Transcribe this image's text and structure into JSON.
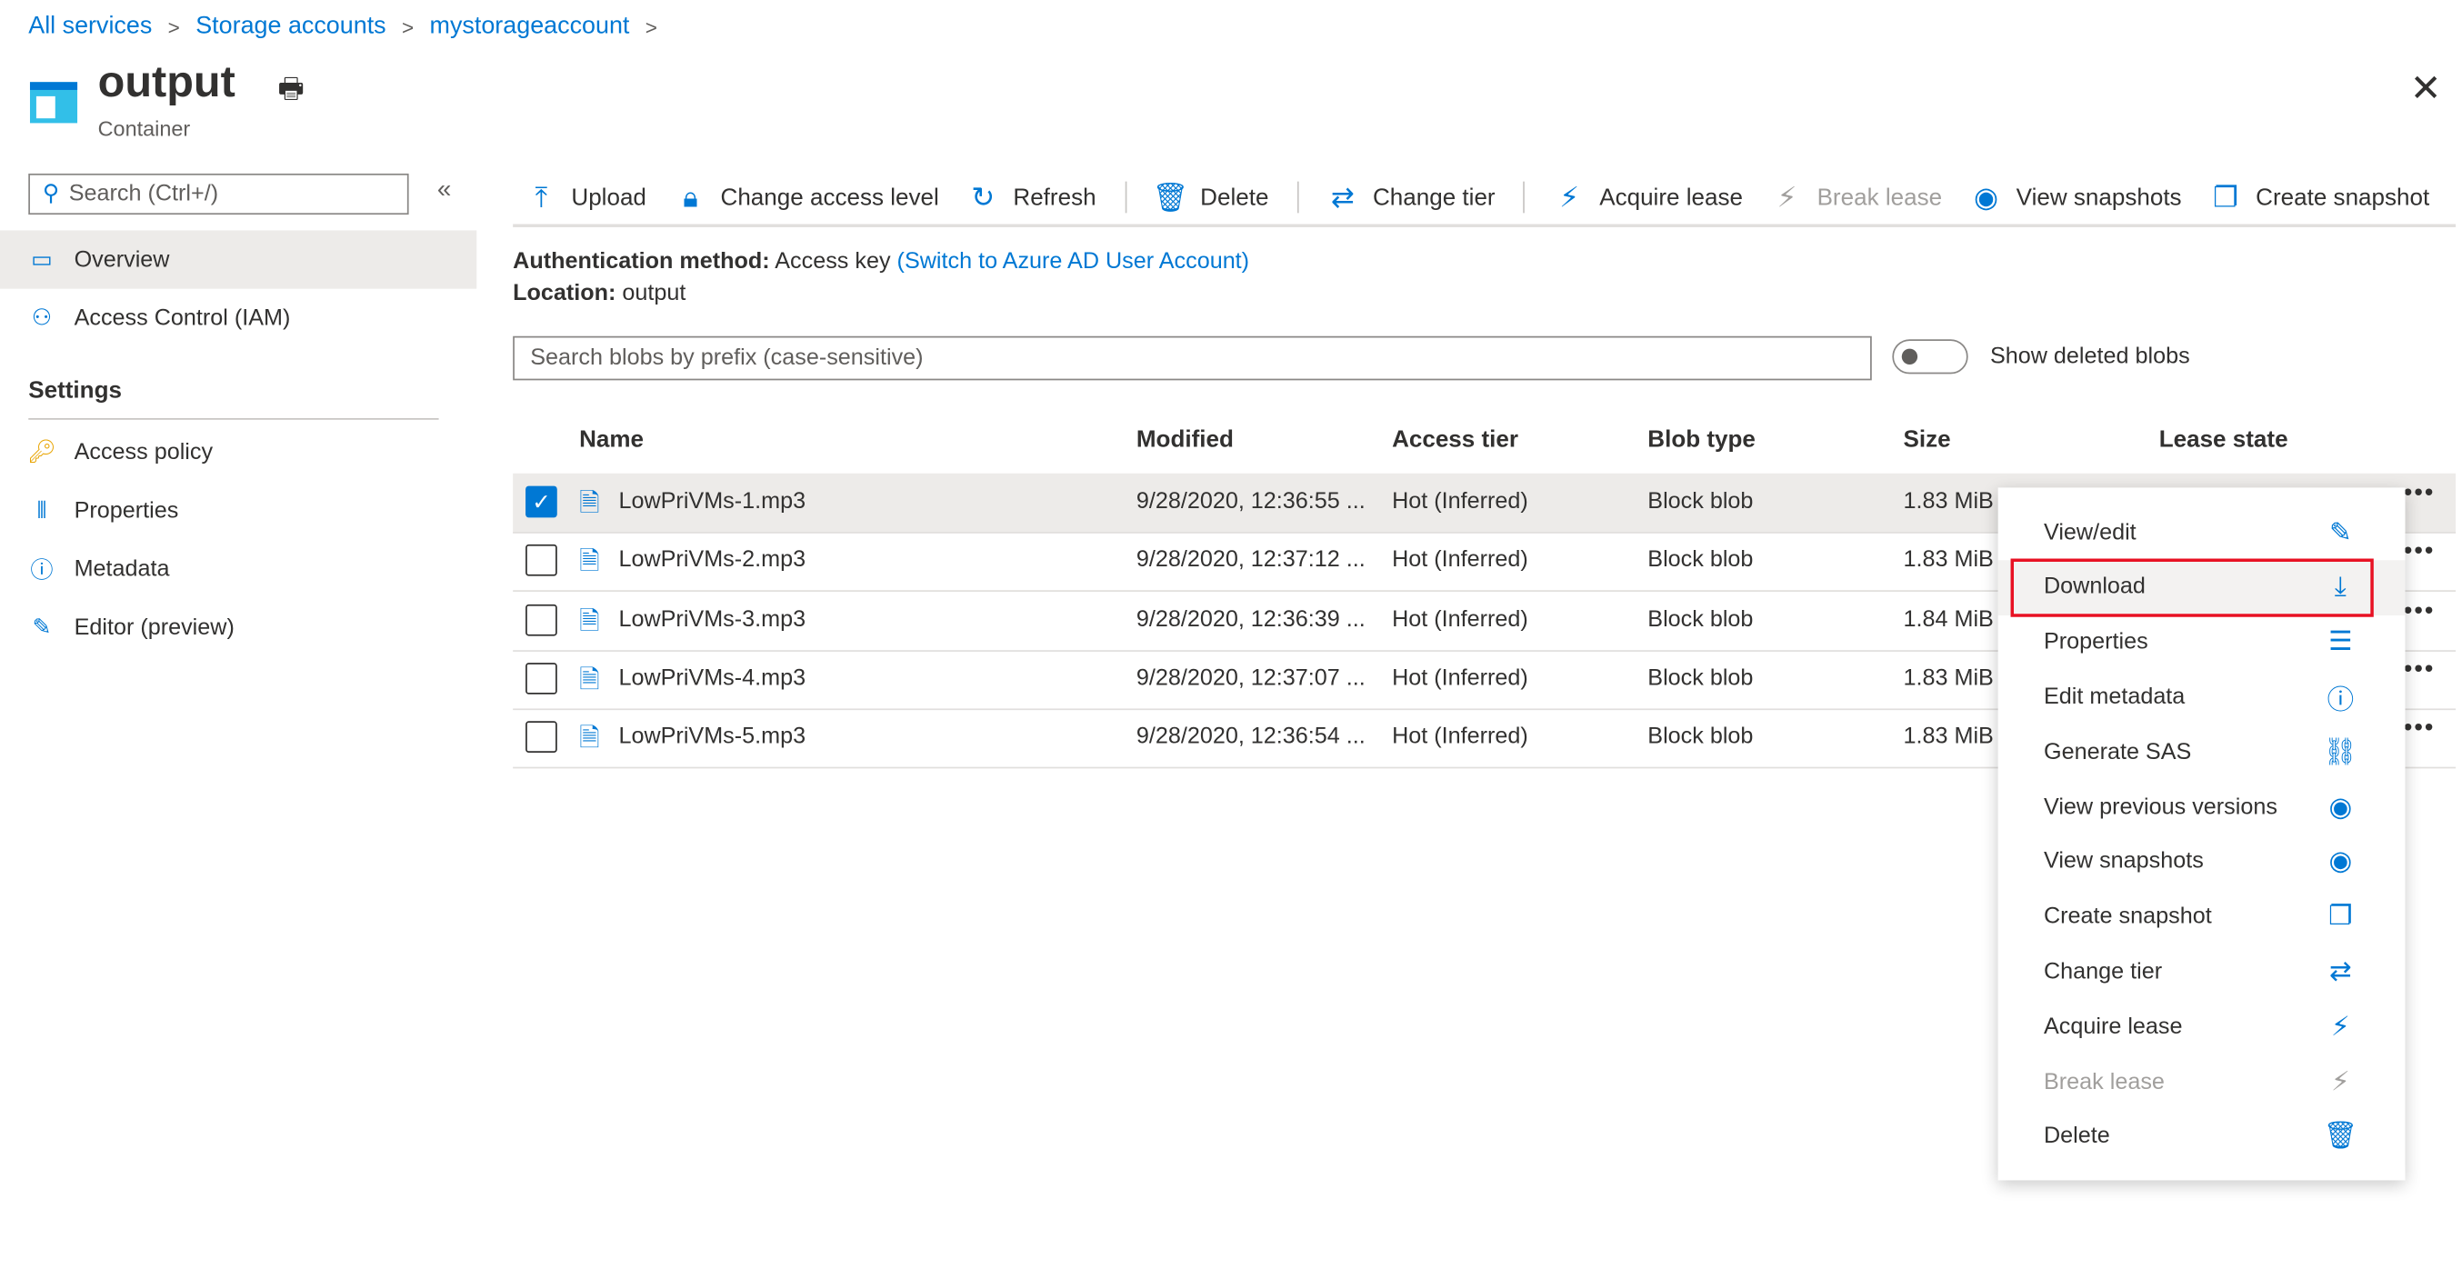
{
  "breadcrumb": [
    "All services",
    "Storage accounts",
    "mystorageaccount"
  ],
  "header": {
    "title": "output",
    "subtitle": "Container"
  },
  "sidebar": {
    "search_placeholder": "Search (Ctrl+/)",
    "items": [
      {
        "label": "Overview",
        "icon": "container-icon"
      },
      {
        "label": "Access Control (IAM)",
        "icon": "people-icon"
      }
    ],
    "section": "Settings",
    "settings_items": [
      {
        "label": "Access policy",
        "icon": "key-icon"
      },
      {
        "label": "Properties",
        "icon": "bars-icon"
      },
      {
        "label": "Metadata",
        "icon": "info-icon"
      },
      {
        "label": "Editor (preview)",
        "icon": "pencil-icon"
      }
    ]
  },
  "toolbar": [
    "Upload",
    "Change access level",
    "Refresh",
    "Delete",
    "Change tier",
    "Acquire lease",
    "Break lease",
    "View snapshots",
    "Create snapshot"
  ],
  "info": {
    "auth_label": "Authentication method:",
    "auth_value": "Access key",
    "auth_link": "(Switch to Azure AD User Account)",
    "loc_label": "Location:",
    "loc_value": "output"
  },
  "blob_search_placeholder": "Search blobs by prefix (case-sensitive)",
  "show_deleted_label": "Show deleted blobs",
  "show_deleted": false,
  "columns": [
    "Name",
    "Modified",
    "Access tier",
    "Blob type",
    "Size",
    "Lease state"
  ],
  "rows": [
    {
      "name": "LowPriVMs-1.mp3",
      "modified": "9/28/2020, 12:36:55 ...",
      "tier": "Hot (Inferred)",
      "type": "Block blob",
      "size": "1.83 MiB",
      "checked": true
    },
    {
      "name": "LowPriVMs-2.mp3",
      "modified": "9/28/2020, 12:37:12 ...",
      "tier": "Hot (Inferred)",
      "type": "Block blob",
      "size": "1.83 MiB",
      "checked": false
    },
    {
      "name": "LowPriVMs-3.mp3",
      "modified": "9/28/2020, 12:36:39 ...",
      "tier": "Hot (Inferred)",
      "type": "Block blob",
      "size": "1.84 MiB",
      "checked": false
    },
    {
      "name": "LowPriVMs-4.mp3",
      "modified": "9/28/2020, 12:37:07 ...",
      "tier": "Hot (Inferred)",
      "type": "Block blob",
      "size": "1.83 MiB",
      "checked": false
    },
    {
      "name": "LowPriVMs-5.mp3",
      "modified": "9/28/2020, 12:36:54 ...",
      "tier": "Hot (Inferred)",
      "type": "Block blob",
      "size": "1.83 MiB",
      "checked": false
    }
  ],
  "context_menu": [
    {
      "label": "View/edit",
      "icon": "pencil-icon"
    },
    {
      "label": "Download",
      "icon": "download-icon",
      "highlighted": true
    },
    {
      "label": "Properties",
      "icon": "sliders-icon"
    },
    {
      "label": "Edit metadata",
      "icon": "info-icon"
    },
    {
      "label": "Generate SAS",
      "icon": "link-icon"
    },
    {
      "label": "View previous versions",
      "icon": "eye-icon"
    },
    {
      "label": "View snapshots",
      "icon": "eye-icon"
    },
    {
      "label": "Create snapshot",
      "icon": "snapshot-icon"
    },
    {
      "label": "Change tier",
      "icon": "swap-icon"
    },
    {
      "label": "Acquire lease",
      "icon": "plug-icon"
    },
    {
      "label": "Break lease",
      "icon": "unplug-icon",
      "disabled": true
    },
    {
      "label": "Delete",
      "icon": "trash-icon"
    }
  ],
  "colors": {
    "accent": "#0078d4",
    "highlight_border": "#e81123"
  }
}
